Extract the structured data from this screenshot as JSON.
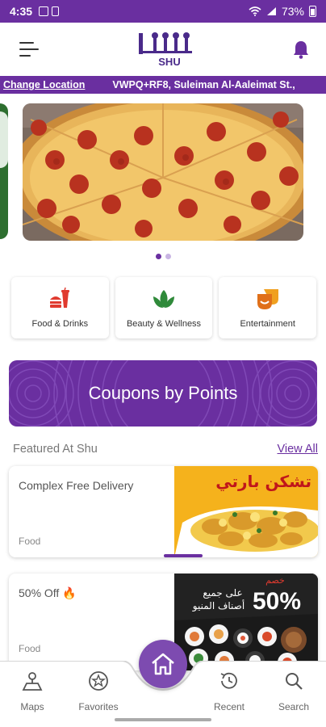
{
  "status_bar": {
    "time": "4:35",
    "battery": "73%"
  },
  "header": {
    "logo_text": "SHU"
  },
  "location": {
    "change_label": "Change Location",
    "address": "VWPQ+RF8, Suleiman Al-Aaleimat St.,"
  },
  "carousel": {
    "page_count": 2,
    "active_index": 0
  },
  "categories": [
    {
      "label": "Food & Drinks",
      "icon": "food-drinks-icon"
    },
    {
      "label": "Beauty & Wellness",
      "icon": "leaf-icon"
    },
    {
      "label": "Entertainment",
      "icon": "entertainment-icon"
    }
  ],
  "coupons": {
    "label": "Coupons by Points"
  },
  "featured": {
    "title": "Featured At Shu",
    "view_all": "View All",
    "cards": [
      {
        "title": "Complex Free Delivery",
        "category": "Food",
        "image_text": "تشكن بارتي"
      },
      {
        "title": "50% Off 🔥",
        "category": "Food",
        "image_text_1": "خصم",
        "image_text_2": "على جميع",
        "image_text_3": "أصناف المنيو",
        "image_percent": "50%"
      }
    ]
  },
  "bottom_nav": {
    "items": [
      {
        "label": "Maps",
        "icon": "map-person-icon"
      },
      {
        "label": "Favorites",
        "icon": "star-icon"
      },
      {
        "label": "Home",
        "icon": "home-icon"
      },
      {
        "label": "Recent",
        "icon": "history-icon"
      },
      {
        "label": "Search",
        "icon": "search-icon"
      }
    ]
  },
  "colors": {
    "brand": "#6a2fa0",
    "accent_orange": "#f0a020",
    "food_red": "#e03a2f",
    "wellness_green": "#2f8a3a"
  }
}
